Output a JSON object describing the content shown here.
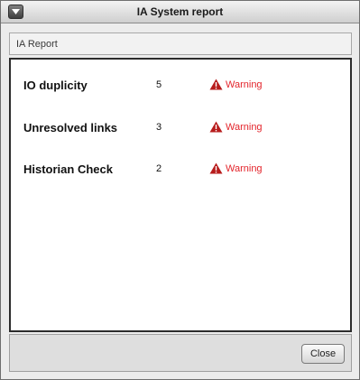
{
  "window": {
    "title": "IA System report"
  },
  "header": {
    "label": "IA Report"
  },
  "report": {
    "rows": [
      {
        "label": "IO duplicity",
        "count": "5",
        "status": "Warning"
      },
      {
        "label": "Unresolved links",
        "count": "3",
        "status": "Warning"
      },
      {
        "label": "Historian Check",
        "count": "2",
        "status": "Warning"
      }
    ]
  },
  "footer": {
    "close_label": "Close"
  },
  "icons": {
    "window_menu": "window-menu-icon",
    "warning": "warning-triangle-icon"
  },
  "colors": {
    "warning_text": "#e3242b",
    "warning_icon": "#b71c1c"
  }
}
